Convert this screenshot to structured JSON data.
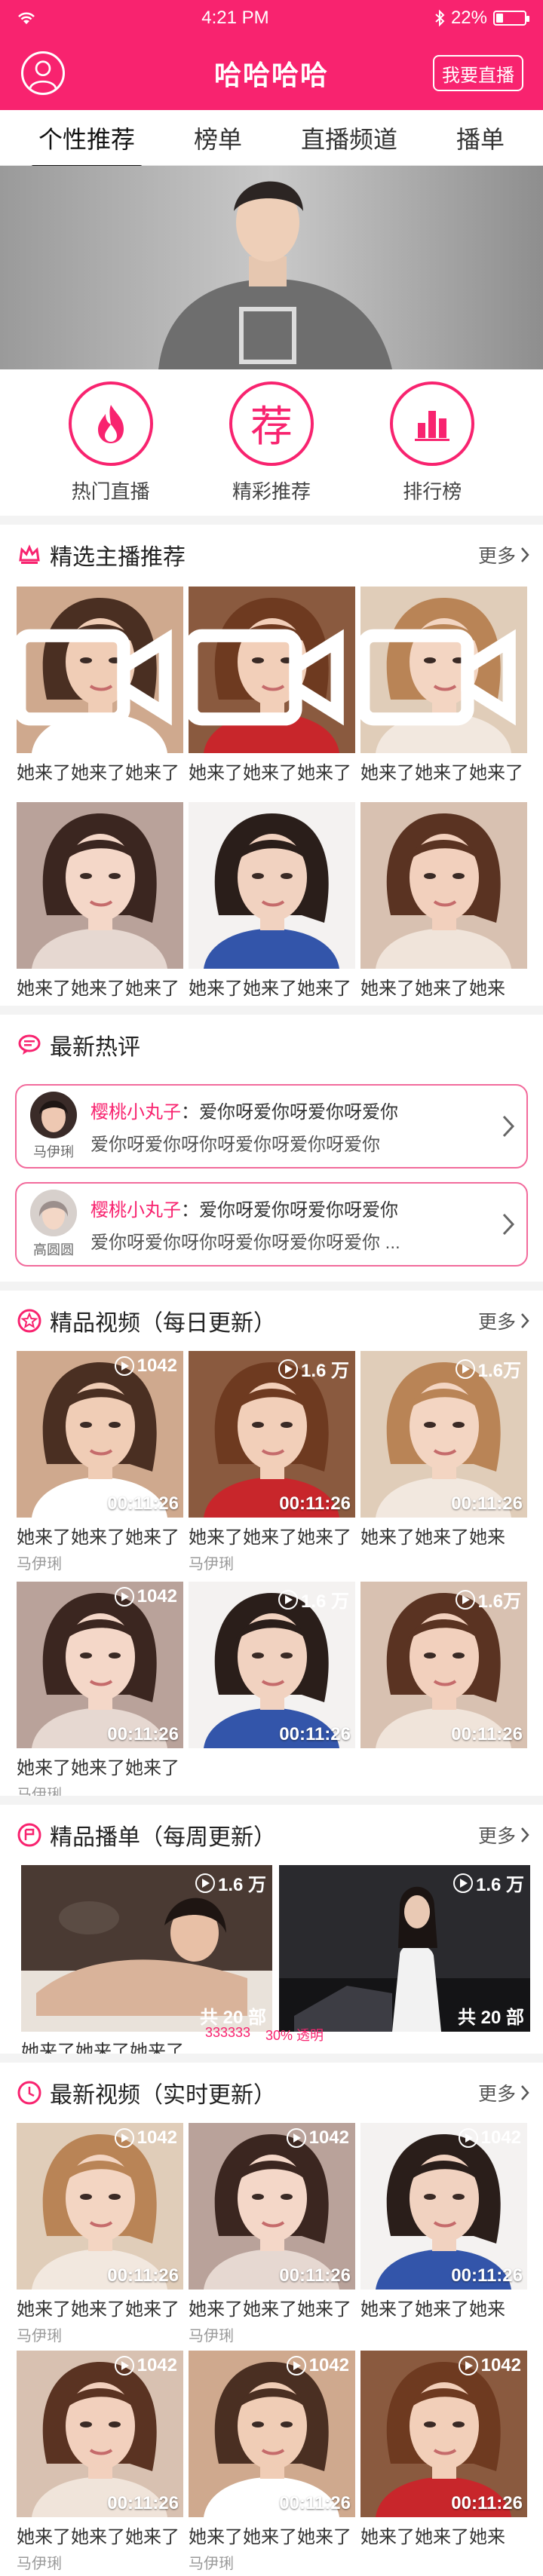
{
  "status_bar": {
    "time": "4:21 PM",
    "battery": "22%",
    "battery_level": 0.22
  },
  "header": {
    "title": "哈哈哈哈",
    "live_button": "我要直播"
  },
  "tabs": [
    {
      "label": "个性推荐",
      "active": true
    },
    {
      "label": "榜单",
      "active": false
    },
    {
      "label": "直播频道",
      "active": false
    },
    {
      "label": "播单",
      "active": false
    }
  ],
  "quick_links": [
    {
      "label": "热门直播",
      "icon": "flame-icon"
    },
    {
      "label": "精彩推荐",
      "icon": "recommend-icon",
      "glyph": "荐"
    },
    {
      "label": "排行榜",
      "icon": "bar-chart-icon"
    }
  ],
  "more_label": "更多",
  "featured_hosts": {
    "title": "精选主播推荐",
    "cards": [
      {
        "caption": "她来了她来了她来了"
      },
      {
        "caption": "她来了她来了她来了"
      },
      {
        "caption": "她来了她来了她来了"
      },
      {
        "caption": "她来了她来了她来了"
      },
      {
        "caption": "她来了她来了她来了"
      },
      {
        "caption": "她来了她来了她来"
      }
    ]
  },
  "hot_comments": {
    "title": "最新热评",
    "items": [
      {
        "nickname": "樱桃小丸子",
        "text1": "：爱你呀爱你呀爱你呀爱你",
        "text2": "爱你呀爱你呀你呀爱你呀爱你呀爱你",
        "author": "马伊琍"
      },
      {
        "nickname": "樱桃小丸子",
        "text1": "：爱你呀爱你呀爱你呀爱你",
        "text2": "爱你呀爱你呀你呀爱你呀爱你呀爱你 ...",
        "author": "高圆圆"
      }
    ]
  },
  "daily_videos": {
    "title": "精品视频（每日更新）",
    "cards": [
      {
        "plays": "1042",
        "duration": "00:11:26",
        "caption": "她来了她来了她来了",
        "author": "马伊琍"
      },
      {
        "plays": "1.6 万",
        "duration": "00:11:26",
        "caption": "她来了她来了她来了",
        "author": "马伊琍"
      },
      {
        "plays": "1.6万",
        "duration": "00:11:26",
        "caption": "她来了她来了她来",
        "author": ""
      },
      {
        "plays": "1042",
        "duration": "00:11:26",
        "caption": "她来了她来了她来了",
        "author": "马伊琍"
      },
      {
        "plays": "1.6 万",
        "duration": "00:11:26",
        "caption": "",
        "author": ""
      },
      {
        "plays": "1.6万",
        "duration": "00:11:26",
        "caption": "",
        "author": ""
      }
    ]
  },
  "weekly_playlists": {
    "title": "精品播单（每周更新）",
    "cards": [
      {
        "plays": "1.6 万",
        "count": "共 20 部",
        "caption": "她来了她来了她来了"
      },
      {
        "plays": "1.6 万",
        "count": "共 20 部",
        "caption": ""
      }
    ],
    "meta_count": "333333",
    "meta_percent": "30% 透明"
  },
  "latest_videos": {
    "title": "最新视频（实时更新）",
    "cards": [
      {
        "plays": "1042",
        "duration": "00:11:26",
        "caption": "她来了她来了她来了",
        "author": "马伊琍"
      },
      {
        "plays": "1042",
        "duration": "00:11:26",
        "caption": "她来了她来了她来了",
        "author": "马伊琍"
      },
      {
        "plays": "1042",
        "duration": "00:11:26",
        "caption": "她来了她来了她来",
        "author": ""
      },
      {
        "plays": "1042",
        "duration": "00:11:26",
        "caption": "她来了她来了她来了",
        "author": "马伊琍"
      },
      {
        "plays": "1042",
        "duration": "00:11:26",
        "caption": "她来了她来了她来了",
        "author": "马伊琍"
      },
      {
        "plays": "1042",
        "duration": "00:11:26",
        "caption": "她来了她来了她来",
        "author": ""
      }
    ]
  },
  "colors": {
    "brand": "#f8236f",
    "divider": "#f3f3f3"
  }
}
